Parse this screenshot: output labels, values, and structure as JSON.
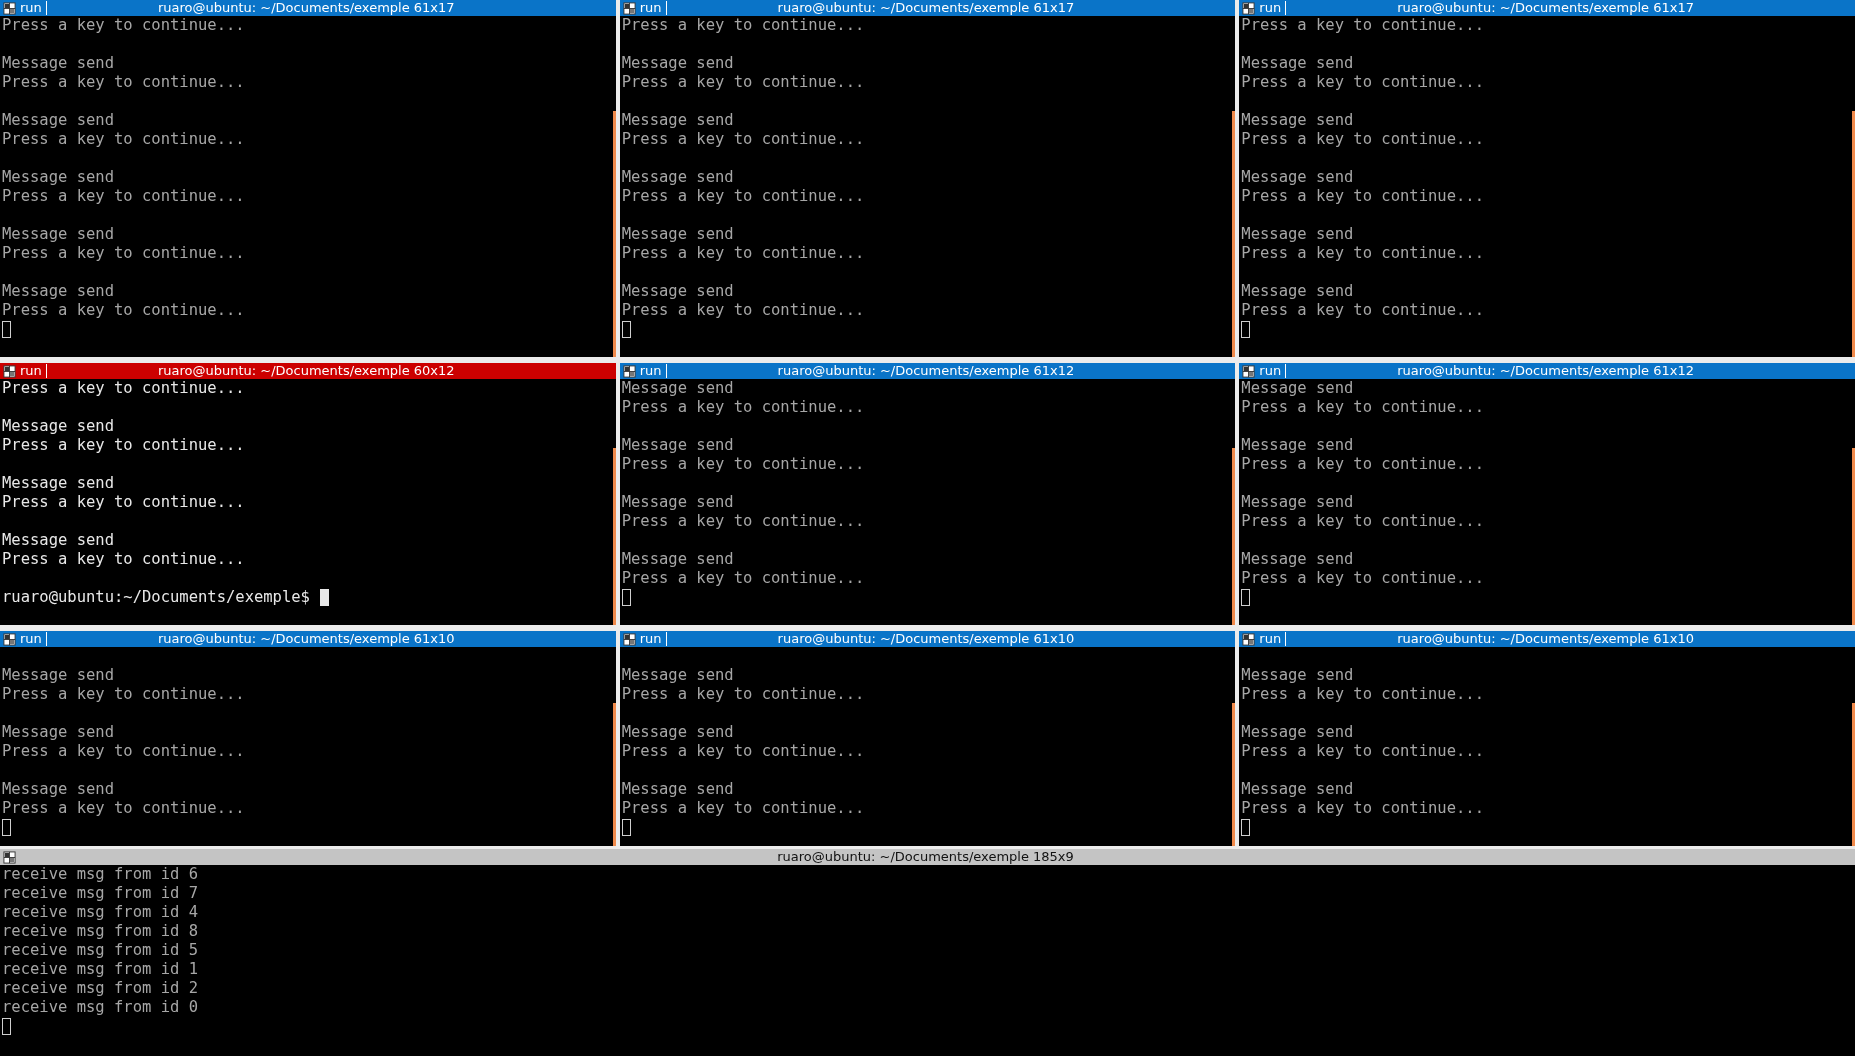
{
  "rows": [
    {
      "panes": [
        {
          "tab_label": "run",
          "title": "ruaro@ubuntu: ~/Documents/exemple 61x17",
          "focused": false,
          "blank_first": false,
          "blocks": [
            [
              "Press a key to continue..."
            ],
            [
              "Message send",
              "Press a key to continue..."
            ],
            [
              "Message send",
              "Press a key to continue..."
            ],
            [
              "Message send",
              "Press a key to continue..."
            ],
            [
              "Message send",
              "Press a key to continue..."
            ],
            [
              "Message send",
              "Press a key to continue..."
            ]
          ]
        },
        {
          "tab_label": "run",
          "title": "ruaro@ubuntu: ~/Documents/exemple 61x17",
          "focused": false,
          "blank_first": false,
          "blocks": [
            [
              "Press a key to continue..."
            ],
            [
              "Message send",
              "Press a key to continue..."
            ],
            [
              "Message send",
              "Press a key to continue..."
            ],
            [
              "Message send",
              "Press a key to continue..."
            ],
            [
              "Message send",
              "Press a key to continue..."
            ],
            [
              "Message send",
              "Press a key to continue..."
            ]
          ]
        },
        {
          "tab_label": "run",
          "title": "ruaro@ubuntu: ~/Documents/exemple 61x17",
          "focused": false,
          "blank_first": false,
          "blocks": [
            [
              "Press a key to continue..."
            ],
            [
              "Message send",
              "Press a key to continue..."
            ],
            [
              "Message send",
              "Press a key to continue..."
            ],
            [
              "Message send",
              "Press a key to continue..."
            ],
            [
              "Message send",
              "Press a key to continue..."
            ],
            [
              "Message send",
              "Press a key to continue..."
            ]
          ]
        }
      ]
    },
    {
      "panes": [
        {
          "tab_label": "run",
          "title": "ruaro@ubuntu: ~/Documents/exemple 60x12",
          "focused": true,
          "blank_first": false,
          "blocks": [
            [
              "Press a key to continue..."
            ],
            [
              "Message send",
              "Press a key to continue..."
            ],
            [
              "Message send",
              "Press a key to continue..."
            ],
            [
              "Message send",
              "Press a key to continue..."
            ],
            [
              "ruaro@ubuntu:~/Documents/exemple$"
            ]
          ]
        },
        {
          "tab_label": "run",
          "title": "ruaro@ubuntu: ~/Documents/exemple 61x12",
          "focused": false,
          "blank_first": false,
          "blocks": [
            [
              "Message send",
              "Press a key to continue..."
            ],
            [
              "Message send",
              "Press a key to continue..."
            ],
            [
              "Message send",
              "Press a key to continue..."
            ],
            [
              "Message send",
              "Press a key to continue..."
            ]
          ]
        },
        {
          "tab_label": "run",
          "title": "ruaro@ubuntu: ~/Documents/exemple 61x12",
          "focused": false,
          "blank_first": false,
          "blocks": [
            [
              "Message send",
              "Press a key to continue..."
            ],
            [
              "Message send",
              "Press a key to continue..."
            ],
            [
              "Message send",
              "Press a key to continue..."
            ],
            [
              "Message send",
              "Press a key to continue..."
            ]
          ]
        }
      ]
    },
    {
      "panes": [
        {
          "tab_label": "run",
          "title": "ruaro@ubuntu: ~/Documents/exemple 61x10",
          "focused": false,
          "blank_first": true,
          "blocks": [
            [
              "Message send",
              "Press a key to continue..."
            ],
            [
              "Message send",
              "Press a key to continue..."
            ],
            [
              "Message send",
              "Press a key to continue..."
            ]
          ]
        },
        {
          "tab_label": "run",
          "title": "ruaro@ubuntu: ~/Documents/exemple 61x10",
          "focused": false,
          "blank_first": true,
          "blocks": [
            [
              "Message send",
              "Press a key to continue..."
            ],
            [
              "Message send",
              "Press a key to continue..."
            ],
            [
              "Message send",
              "Press a key to continue..."
            ]
          ]
        },
        {
          "tab_label": "run",
          "title": "ruaro@ubuntu: ~/Documents/exemple 61x10",
          "focused": false,
          "blank_first": true,
          "blocks": [
            [
              "Message send",
              "Press a key to continue..."
            ],
            [
              "Message send",
              "Press a key to continue..."
            ],
            [
              "Message send",
              "Press a key to continue..."
            ]
          ]
        }
      ]
    }
  ],
  "bottom_pane": {
    "title": "ruaro@ubuntu: ~/Documents/exemple 185x9",
    "focused": false,
    "blank_first": false,
    "blocks": [
      [
        "receive msg from id 6",
        "receive msg from id 7",
        "receive msg from id 4",
        "receive msg from id 8",
        "receive msg from id 5",
        "receive msg from id 1",
        "receive msg from id 2",
        "receive msg from id 0"
      ]
    ]
  }
}
